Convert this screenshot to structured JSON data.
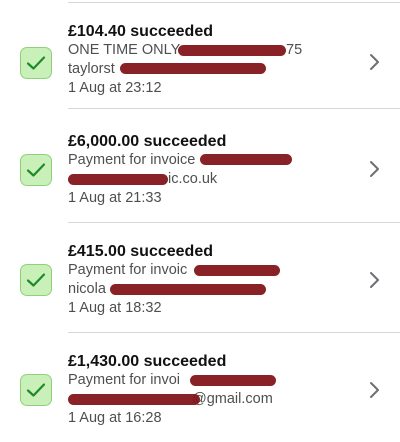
{
  "colors": {
    "check_bg": "#c9f0b9",
    "check_stroke": "#1d8a2c",
    "redaction": "#7e0f14",
    "divider": "#d6d6da"
  },
  "icons": {
    "status": "checkmark-icon",
    "disclosure": "chevron-right-icon"
  },
  "payments": [
    {
      "title": "£104.40 succeeded",
      "line1": "ONE TIME ONLY",
      "line1_tail": "75",
      "line2": "taylorst",
      "line2_tail": "",
      "date": "1 Aug at 23:12"
    },
    {
      "title": "£6,000.00 succeeded",
      "line1": "Payment for invoice",
      "line1_tail": "",
      "line2": "",
      "line2_tail": "ic.co.uk",
      "date": "1 Aug at 21:33"
    },
    {
      "title": "£415.00 succeeded",
      "line1": "Payment for invoic",
      "line1_tail": "",
      "line2": "nicola",
      "line2_tail": "",
      "date": "1 Aug at 18:32"
    },
    {
      "title": "£1,430.00 succeeded",
      "line1": "Payment for invoi",
      "line1_tail": "",
      "line2": "",
      "line2_tail": "@gmail.com",
      "date": "1 Aug at 16:28"
    }
  ]
}
